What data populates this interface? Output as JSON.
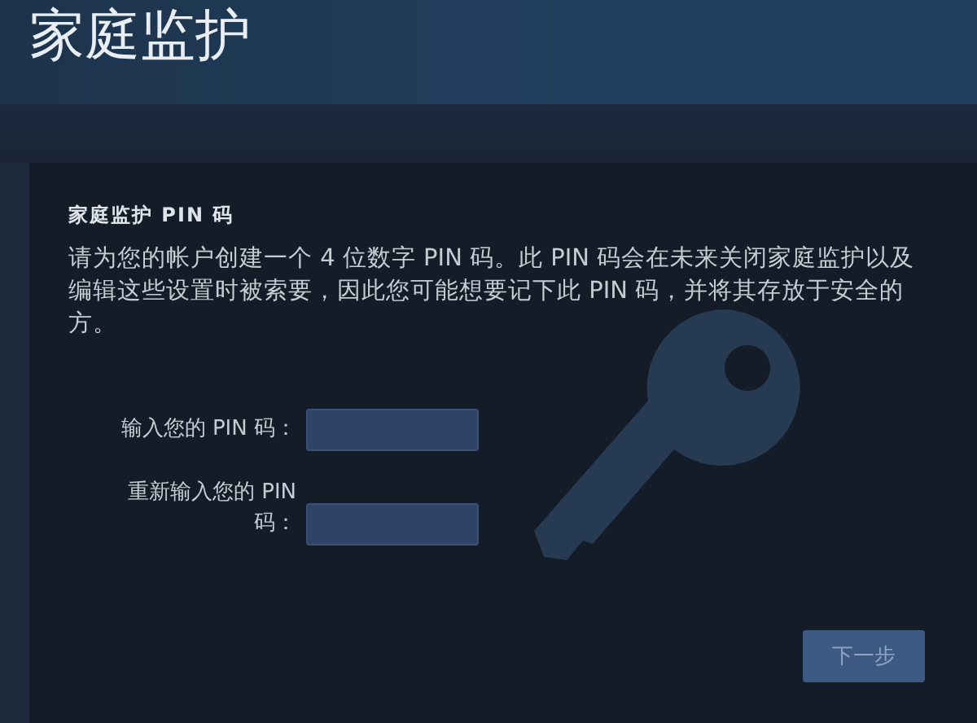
{
  "window": {
    "title": "家庭监护"
  },
  "section": {
    "heading": "家庭监护 PIN 码",
    "description_lines": [
      "请为您的帐户创建一个 4 位数字 PIN 码。此 PIN 码会在未来关闭家庭监护以及",
      "编辑这些设置时被索要，因此您可能想要记下此 PIN 码，并将其存放于安全的",
      "方。"
    ]
  },
  "fields": [
    {
      "label_lines": [
        "输入您的 PIN 码："
      ]
    },
    {
      "label_lines": [
        "重新输入您的 PIN",
        "码："
      ]
    }
  ],
  "buttons": [
    "下一步"
  ]
}
